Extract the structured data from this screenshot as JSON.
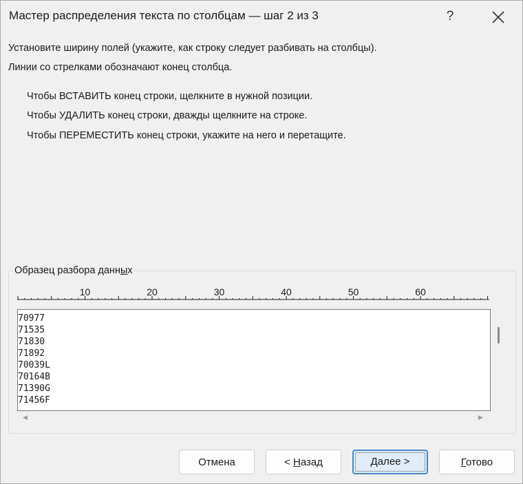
{
  "dialog": {
    "title": "Мастер распределения текста по столбцам — шаг 2 из 3",
    "help_label": "?",
    "intro_line1": "Установите ширину полей (укажите, как строку следует разбивать на столбцы).",
    "intro_line2": "Линии со стрелками обозначают конец столбца.",
    "hint_insert": "Чтобы ВСТАВИТЬ конец строки, щелкните в нужной позиции.",
    "hint_delete": "Чтобы УДАЛИТЬ конец строки, дважды щелкните на строке.",
    "hint_move": "Чтобы ПЕРЕМЕСТИТЬ конец строки, укажите на него и перетащите."
  },
  "preview": {
    "group_label_prefix": "Образец разбора данн",
    "group_label_accel": "ы",
    "group_label_suffix": "х",
    "ruler_labels": [
      "10",
      "20",
      "30",
      "40",
      "50",
      "60"
    ],
    "lines": [
      "70977",
      "71535",
      "71830",
      "71892",
      "70039L",
      "70164B",
      "71390G",
      "71456F"
    ]
  },
  "buttons": {
    "cancel": {
      "label": "Отмена"
    },
    "back": {
      "prefix": "< ",
      "accel": "Н",
      "rest": "азад"
    },
    "next": {
      "accel": "Д",
      "rest": "алее >"
    },
    "finish": {
      "accel": "Г",
      "rest": "отово"
    }
  }
}
